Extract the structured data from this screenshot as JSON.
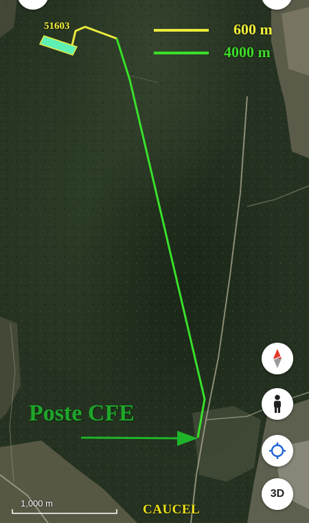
{
  "map": {
    "type": "satellite",
    "lot_label": "51603",
    "destination_label": "Poste CFE",
    "town_label": "CAUCEL",
    "scale_bar_text": "1,000 m"
  },
  "legend": {
    "items": [
      {
        "distance": "600 m",
        "color": "#f1ef3a"
      },
      {
        "distance": "4000 m",
        "color": "#3ddc2a"
      }
    ]
  },
  "colors": {
    "yellow_route": "#e8ea3c",
    "green_route": "#39e02a",
    "lot_fill": "#5ff0b4",
    "arrow": "#1fb52a",
    "compass_red": "#e23a2a"
  },
  "controls": {
    "compass": "compass-icon",
    "street_view": "pegman-icon",
    "my_location": "crosshair-icon",
    "view_3d": "3D"
  }
}
